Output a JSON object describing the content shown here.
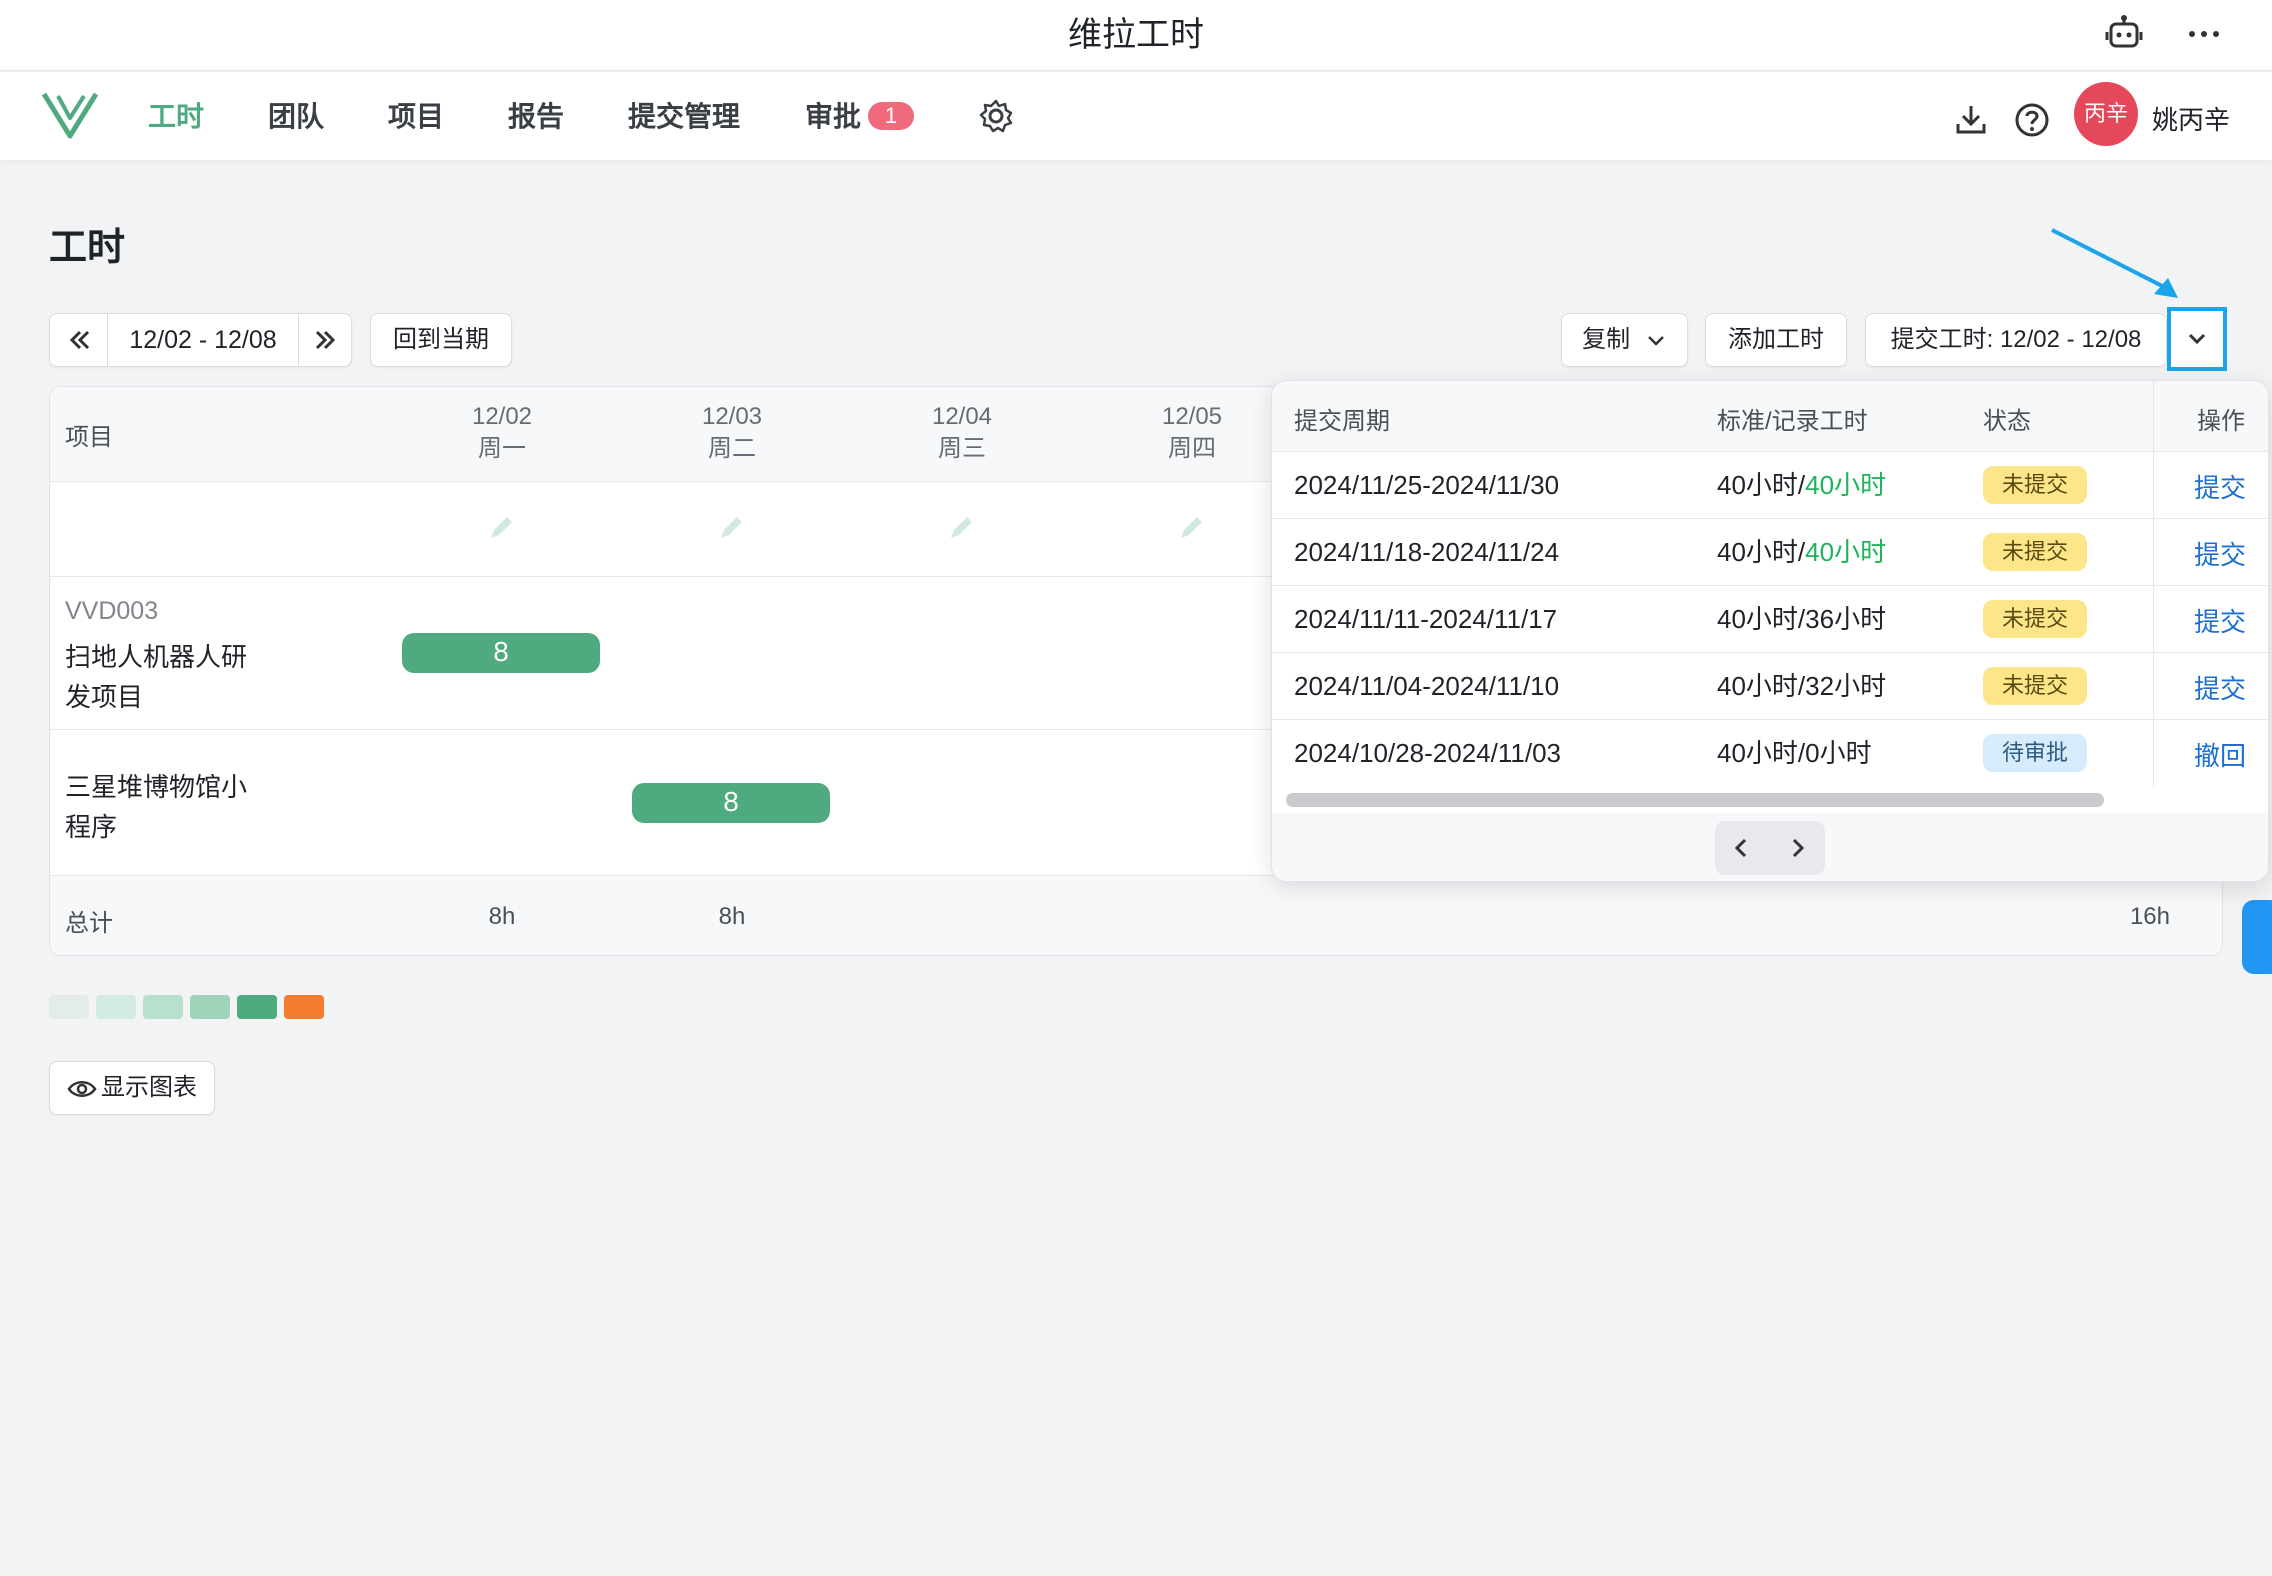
{
  "window": {
    "title": "维拉工时"
  },
  "nav": {
    "items": [
      {
        "label": "工时",
        "active": true
      },
      {
        "label": "团队"
      },
      {
        "label": "项目"
      },
      {
        "label": "报告"
      },
      {
        "label": "提交管理"
      },
      {
        "label": "审批"
      }
    ],
    "approval_count": "1",
    "user": {
      "avatar_text": "丙辛",
      "name": "姚丙辛"
    }
  },
  "page": {
    "title": "工时"
  },
  "toolbar": {
    "date_range": "12/02 - 12/08",
    "back_to_current": "回到当期",
    "copy": "复制",
    "add_hours": "添加工时",
    "submit_hours": "提交工时: 12/02 - 12/08"
  },
  "grid": {
    "project_header": "项目",
    "days": [
      {
        "date": "12/02",
        "weekday": "周一"
      },
      {
        "date": "12/03",
        "weekday": "周二"
      },
      {
        "date": "12/04",
        "weekday": "周三"
      },
      {
        "date": "12/05",
        "weekday": "周四"
      }
    ],
    "rows": [
      {
        "code": "VVD003",
        "name_line1": "扫地人机器人研",
        "name_line2": "发项目",
        "hours": "8"
      },
      {
        "name_line1": "三星堆博物馆小",
        "name_line2": "程序",
        "hours": "8"
      }
    ],
    "total_label": "总计",
    "day_totals": [
      "8h",
      "8h"
    ],
    "grand_total": "16h"
  },
  "legend": {
    "colors": [
      "#e3ece8",
      "#d3ece1",
      "#b9e0cd",
      "#9fd4ba",
      "#4faa80",
      "#f57c2f"
    ]
  },
  "show_chart": "显示图表",
  "popup": {
    "headers": {
      "period": "提交周期",
      "hours": "标准/记录工时",
      "status": "状态",
      "action": "操作"
    },
    "rows": [
      {
        "period": "2024/11/25-2024/11/30",
        "std": "40小时/",
        "rec": "40小时",
        "status": "未提交",
        "action": "提交"
      },
      {
        "period": "2024/11/18-2024/11/24",
        "std": "40小时/",
        "rec": "40小时",
        "status": "未提交",
        "action": "提交"
      },
      {
        "period": "2024/11/11-2024/11/17",
        "std": "40小时/",
        "rec": "36小时",
        "status": "未提交",
        "action": "提交"
      },
      {
        "period": "2024/11/04-2024/11/10",
        "std": "40小时/",
        "rec": "32小时",
        "status": "未提交",
        "action": "提交"
      },
      {
        "period": "2024/10/28-2024/11/03",
        "std": "40小时/",
        "rec": "0小时",
        "status": "待审批",
        "action": "撤回"
      }
    ]
  }
}
